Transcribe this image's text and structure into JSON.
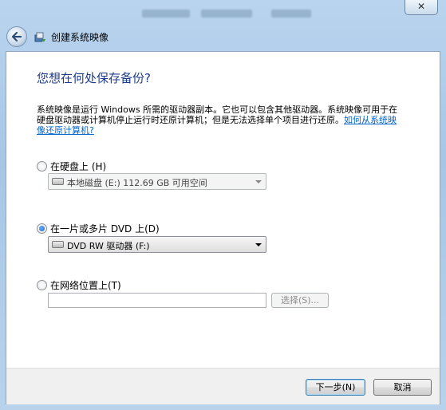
{
  "window": {
    "close_label": "✕"
  },
  "nav": {
    "title": "创建系统映像"
  },
  "main": {
    "heading": "您想在何处保存备份?",
    "description": "系统映像是运行 Windows 所需的驱动器副本。它也可以包含其他驱动器。系统映像可用于在硬盘驱动器或计算机停止运行时还原计算机；但是无法选择单个项目进行还原。",
    "help_link": "如何从系统映像还原计算机?"
  },
  "options": {
    "hard_disk": {
      "label": "在硬盘上 (H)",
      "checked": false,
      "selected_value": "本地磁盘 (E:)  112.69 GB 可用空间"
    },
    "dvd": {
      "label": "在一片或多片 DVD 上(D)",
      "checked": true,
      "selected_value": "DVD RW 驱动器 (F:)"
    },
    "network": {
      "label": "在网络位置上(T)",
      "checked": false,
      "path_value": "",
      "select_button": "选择(S)..."
    }
  },
  "footer": {
    "next_button": "下一步(N)",
    "cancel_button": "取消"
  },
  "colors": {
    "heading": "#1e3c8c",
    "link": "#0066cc",
    "frame": "#a7c6e6"
  }
}
